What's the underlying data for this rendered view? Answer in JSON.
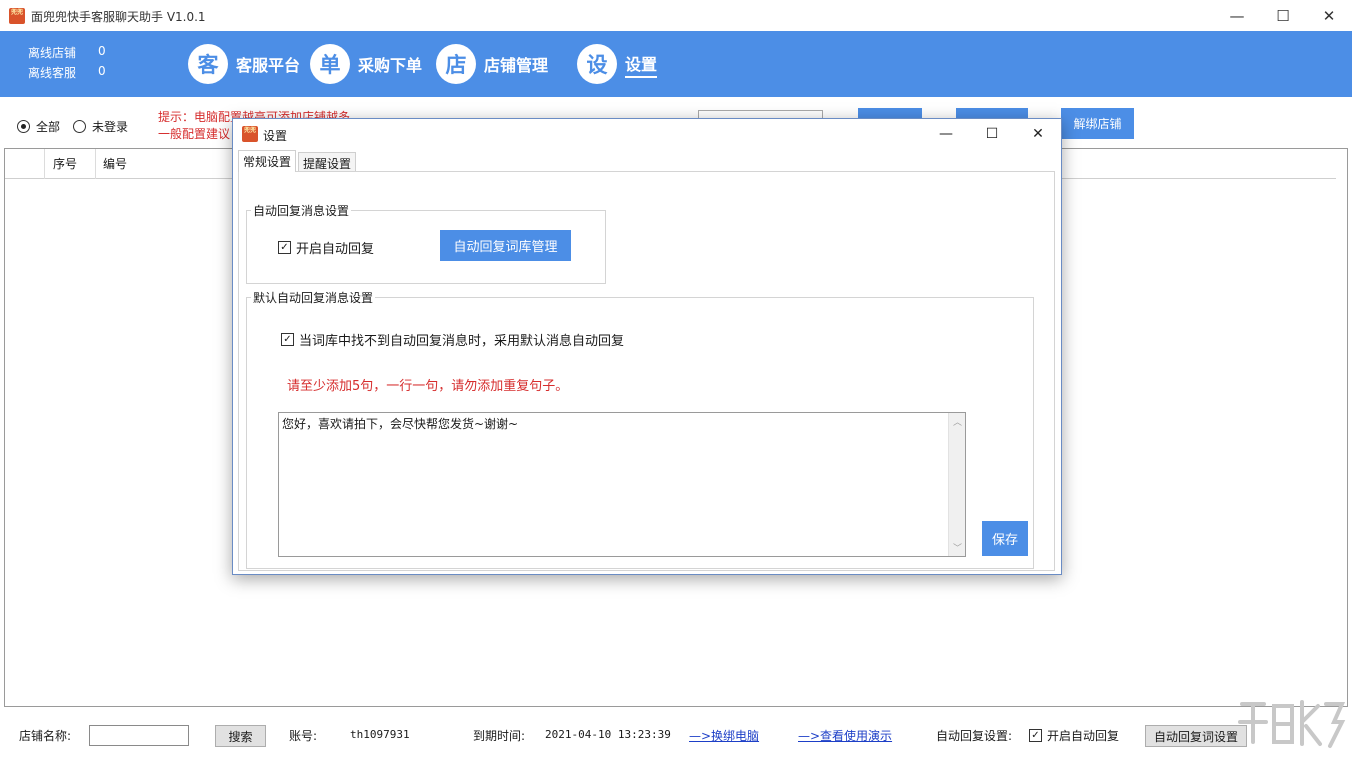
{
  "window": {
    "title": "面兜兜快手客服聊天助手 V1.0.1",
    "logo_text": "兜兜",
    "minimize": "—",
    "maximize": "☐",
    "close": "✕"
  },
  "header": {
    "offline_stores_label": "离线店铺",
    "offline_stores_value": "0",
    "offline_cs_label": "离线客服",
    "offline_cs_value": "0",
    "nav": [
      {
        "icon_char": "客",
        "label": "客服平台"
      },
      {
        "icon_char": "单",
        "label": "采购下单"
      },
      {
        "icon_char": "店",
        "label": "店铺管理"
      },
      {
        "icon_char": "设",
        "label": "设置"
      }
    ]
  },
  "toolbar": {
    "radio_all": "全部",
    "radio_not_logged": "未登录",
    "tip_line1": "提示：电脑配置越高可添加店铺越多",
    "tip_line2": "一般配置建议",
    "btn_partial_1": "",
    "btn_partial_2": "退...",
    "unbind_store": "解绑店铺"
  },
  "table": {
    "columns": [
      "",
      "序号",
      "编号"
    ]
  },
  "bottom": {
    "store_name_label": "店铺名称:",
    "search_button": "搜索",
    "account_label": "账号:",
    "account_value": "th1097931",
    "expiry_label": "到期时间:",
    "expiry_value": "2021-04-10 13:23:39",
    "link_change_pc": "—>换绑电脑",
    "link_demo": "—>查看使用演示",
    "auto_reply_label": "自动回复设置:",
    "auto_reply_check": "开启自动回复",
    "auto_reply_settings_button": "自动回复词设置"
  },
  "dialog": {
    "title": "设置",
    "tabs": [
      "常规设置",
      "提醒设置"
    ],
    "group1_label": "自动回复消息设置",
    "enable_auto_reply": "开启自动回复",
    "manage_library_button": "自动回复词库管理",
    "group2_label": "默认自动回复消息设置",
    "use_default_check": "当词库中找不到自动回复消息时，采用默认消息自动回复",
    "warning": "请至少添加5句，一行一句，请勿添加重复句子。",
    "textarea_value": "您好，喜欢请拍下，会尽快帮您发货~谢谢~",
    "save_button": "保存"
  },
  "colors": {
    "accent": "#4c8ee6",
    "warning_red": "#d62d2d",
    "link_blue": "#1d3fc7"
  }
}
